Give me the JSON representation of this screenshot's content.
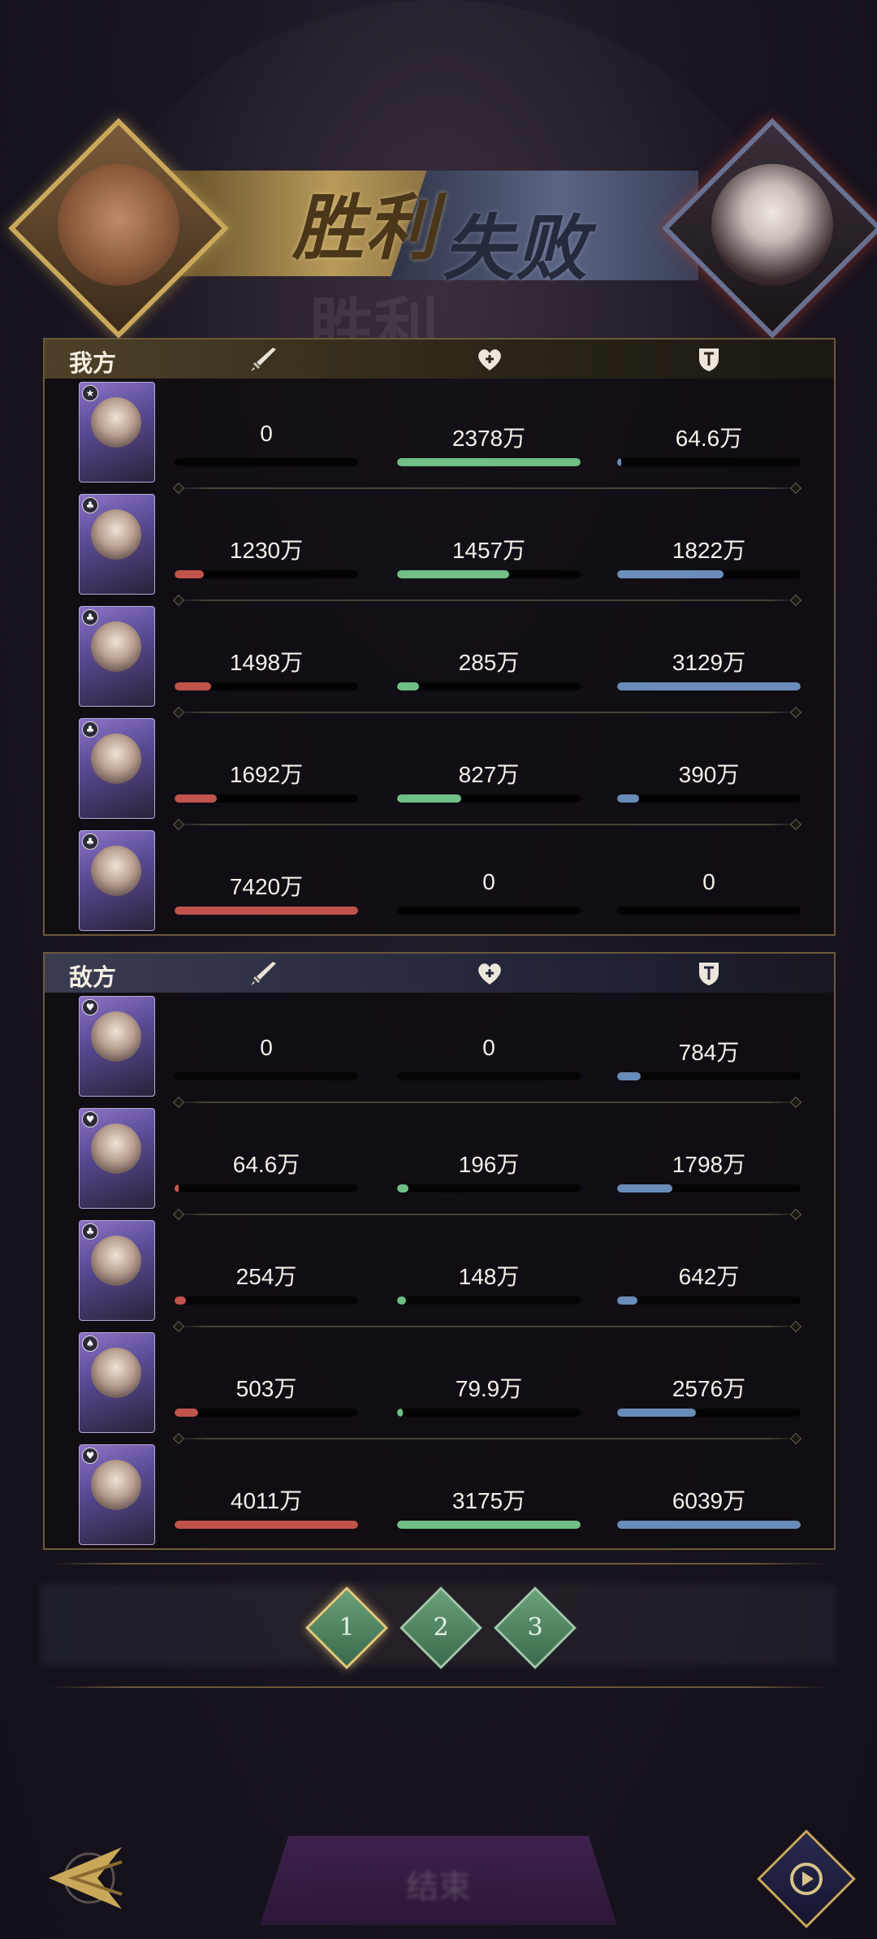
{
  "banner": {
    "win_text": "胜利",
    "lose_text": "失败",
    "left_portrait_icon": "boar-portrait",
    "right_portrait_icon": "white-haired-lady-portrait",
    "accent_gold": "#c9a85a",
    "accent_blue": "#5b6482"
  },
  "ally": {
    "label": "我方",
    "rows": [
      {
        "card_icon": "star-badge",
        "atk": "0",
        "heal": "2378万",
        "def": "64.6万",
        "atk_fill": 0.0,
        "heal_fill": 1.0,
        "def_fill": 0.02
      },
      {
        "card_icon": "club-badge",
        "atk": "1230万",
        "heal": "1457万",
        "def": "1822万",
        "atk_fill": 0.16,
        "heal_fill": 0.61,
        "def_fill": 0.58
      },
      {
        "card_icon": "club-badge",
        "atk": "1498万",
        "heal": "285万",
        "def": "3129万",
        "atk_fill": 0.2,
        "heal_fill": 0.12,
        "def_fill": 1.0
      },
      {
        "card_icon": "club-badge",
        "atk": "1692万",
        "heal": "827万",
        "def": "390万",
        "atk_fill": 0.23,
        "heal_fill": 0.35,
        "def_fill": 0.12
      },
      {
        "card_icon": "club-badge",
        "atk": "7420万",
        "heal": "0",
        "def": "0",
        "atk_fill": 1.0,
        "heal_fill": 0.0,
        "def_fill": 0.0
      }
    ]
  },
  "enemy": {
    "label": "敌方",
    "rows": [
      {
        "card_icon": "heart-badge",
        "atk": "0",
        "heal": "0",
        "def": "784万",
        "atk_fill": 0.0,
        "heal_fill": 0.0,
        "def_fill": 0.13
      },
      {
        "card_icon": "heart-badge",
        "atk": "64.6万",
        "heal": "196万",
        "def": "1798万",
        "atk_fill": 0.02,
        "heal_fill": 0.06,
        "def_fill": 0.3
      },
      {
        "card_icon": "club-badge",
        "atk": "254万",
        "heal": "148万",
        "def": "642万",
        "atk_fill": 0.06,
        "heal_fill": 0.05,
        "def_fill": 0.11
      },
      {
        "card_icon": "spade-badge",
        "atk": "503万",
        "heal": "79.9万",
        "def": "2576万",
        "atk_fill": 0.13,
        "heal_fill": 0.03,
        "def_fill": 0.43
      },
      {
        "card_icon": "heart-badge",
        "atk": "4011万",
        "heal": "3175万",
        "def": "6039万",
        "atk_fill": 1.0,
        "heal_fill": 1.0,
        "def_fill": 1.0
      }
    ]
  },
  "columns": {
    "atk_icon": "sword-icon",
    "heal_icon": "heart-icon",
    "def_icon": "shield-icon",
    "atk_color": "#c0544c",
    "heal_color": "#6fbf86",
    "def_color": "#6a8cb8"
  },
  "pager": {
    "pages": [
      "1",
      "2",
      "3"
    ],
    "active": "1"
  },
  "bottom": {
    "back_icon": "back-arrow-icon",
    "confirm_label": "结束",
    "replay_icon": "replay-icon"
  }
}
